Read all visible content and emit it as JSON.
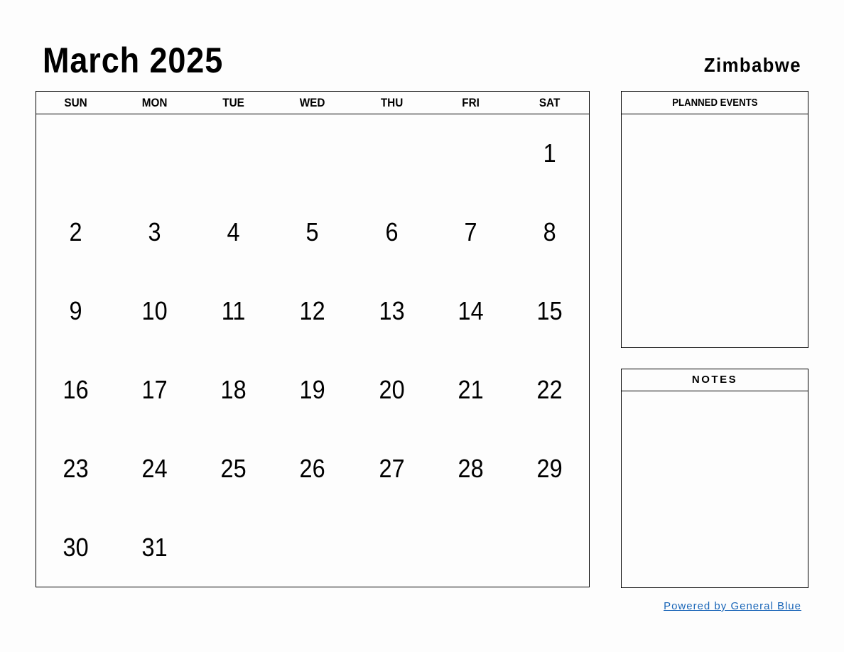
{
  "header": {
    "title": "March 2025",
    "country": "Zimbabwe"
  },
  "calendar": {
    "weekdays": [
      "SUN",
      "MON",
      "TUE",
      "WED",
      "THU",
      "FRI",
      "SAT"
    ],
    "cells": [
      "",
      "",
      "",
      "",
      "",
      "",
      "1",
      "2",
      "3",
      "4",
      "5",
      "6",
      "7",
      "8",
      "9",
      "10",
      "11",
      "12",
      "13",
      "14",
      "15",
      "16",
      "17",
      "18",
      "19",
      "20",
      "21",
      "22",
      "23",
      "24",
      "25",
      "26",
      "27",
      "28",
      "29",
      "30",
      "31",
      "",
      "",
      "",
      "",
      ""
    ]
  },
  "panels": {
    "planned_events": "PLANNED EVENTS",
    "notes": "NOTES"
  },
  "footer": {
    "link_text": "Powered by General Blue",
    "link_color": "#1a66b8"
  }
}
